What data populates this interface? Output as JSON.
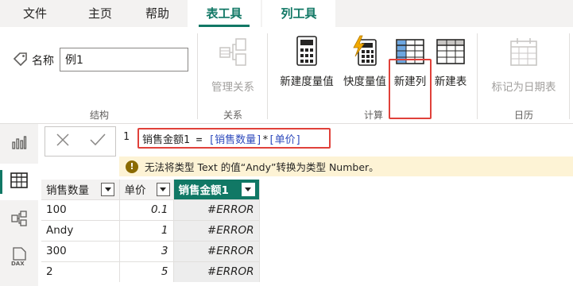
{
  "tabs": [
    {
      "label": "文件"
    },
    {
      "label": "主页"
    },
    {
      "label": "帮助"
    },
    {
      "label": "表工具"
    },
    {
      "label": "列工具"
    }
  ],
  "ribbon": {
    "structure": {
      "name_label": "名称",
      "name_value": "例1",
      "group_label": "结构"
    },
    "relations": {
      "manage_label": "管理关系",
      "group_label": "关系"
    },
    "calc": {
      "new_measure_label": "新建度量值",
      "quick_measure_label": "快度量值",
      "new_column_label": "新建列",
      "new_table_label": "新建表",
      "group_label": "计算"
    },
    "calendar": {
      "mark_date_table_label": "标记为日期表",
      "group_label": "日历"
    }
  },
  "formula_bar": {
    "line_number": "1",
    "name": "销售金额1",
    "equals": " = ",
    "col1": "[销售数量]",
    "op": "*",
    "col2": "[单价]",
    "error_message": "无法将类型 Text 的值“Andy”转换为类型 Number。"
  },
  "table": {
    "headers": [
      "销售数量",
      "单价",
      "销售金额1"
    ],
    "rows": [
      [
        "100",
        "0.1",
        "#ERROR"
      ],
      [
        "Andy",
        "1",
        "#ERROR"
      ],
      [
        "300",
        "3",
        "#ERROR"
      ],
      [
        "2",
        "5",
        "#ERROR"
      ]
    ]
  },
  "colors": {
    "accent": "#117865",
    "highlight": "#e0413a",
    "error_bg": "#fdf3d5"
  }
}
